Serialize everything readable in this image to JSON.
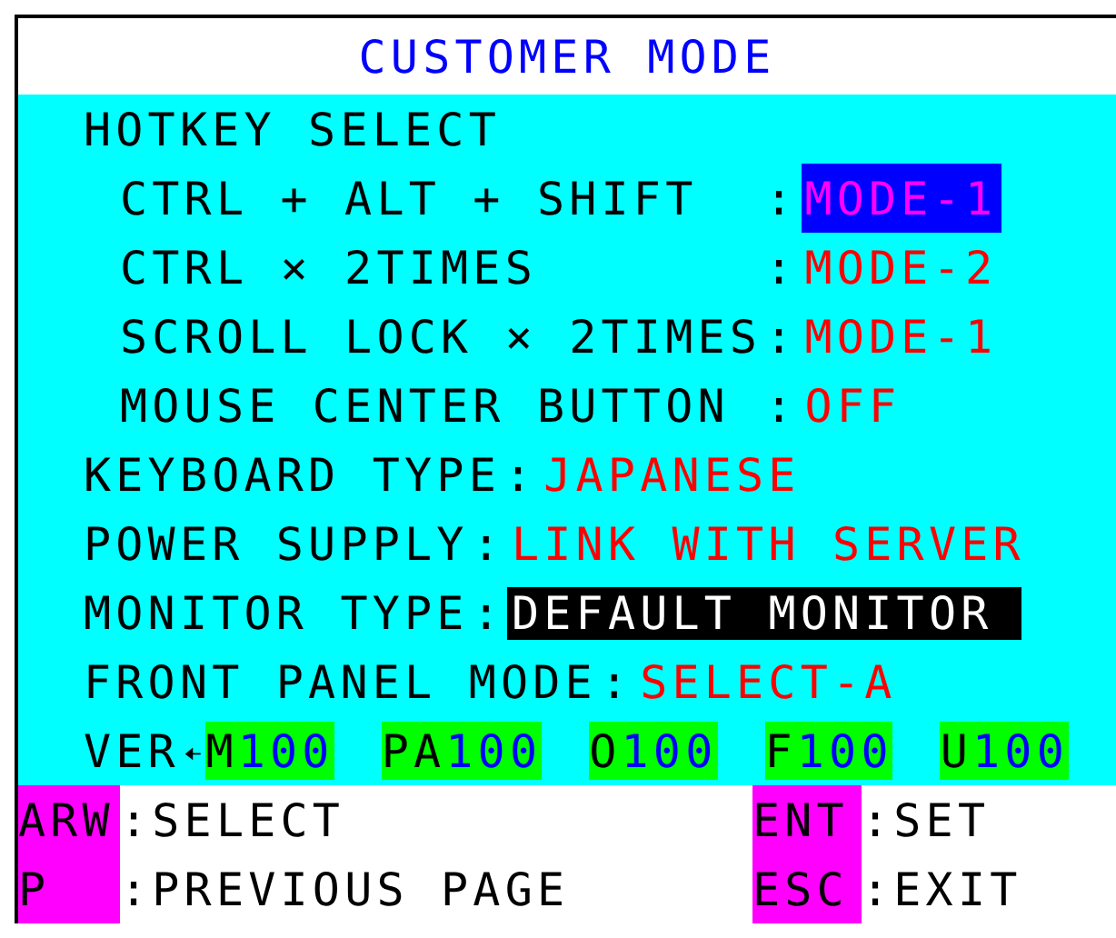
{
  "title": "CUSTOMER MODE",
  "hotkey": {
    "heading": "HOTKEY SELECT",
    "items": [
      {
        "label": "CTRL + ALT + SHIFT",
        "separator": ":",
        "value": "MODE-1",
        "selected": true,
        "inverted": false
      },
      {
        "label": "CTRL × 2TIMES",
        "separator": ":",
        "value": "MODE-2",
        "selected": false,
        "inverted": false
      },
      {
        "label": "SCROLL LOCK × 2TIMES",
        "separator": ":",
        "value": "MODE-1",
        "selected": false,
        "inverted": false
      },
      {
        "label": "MOUSE CENTER BUTTON",
        "separator": ":",
        "value": "OFF",
        "selected": false,
        "inverted": false
      }
    ]
  },
  "settings": [
    {
      "label": "KEYBOARD TYPE",
      "separator": ":",
      "value": "JAPANESE",
      "selected": false,
      "inverted": false
    },
    {
      "label": "POWER SUPPLY",
      "separator": ":",
      "value": "LINK WITH SERVER",
      "selected": false,
      "inverted": false
    },
    {
      "label": "MONITOR TYPE",
      "separator": ":",
      "value": "DEFAULT MONITOR",
      "selected": false,
      "inverted": true
    },
    {
      "label": "FRONT PANEL MODE",
      "separator": ":",
      "value": "SELECT-A",
      "selected": false,
      "inverted": false
    }
  ],
  "version": {
    "label": "VER",
    "modules": [
      {
        "prefix": "M",
        "number": "100"
      },
      {
        "prefix": "PA",
        "number": "100"
      },
      {
        "prefix": "O",
        "number": "100"
      },
      {
        "prefix": "F",
        "number": "100"
      },
      {
        "prefix": "U",
        "number": "100"
      }
    ]
  },
  "footer": [
    {
      "key": "ARW",
      "separator": ":",
      "action": "SELECT"
    },
    {
      "key": "ENT",
      "separator": ":",
      "action": "SET"
    },
    {
      "key": "P",
      "separator": ":",
      "action": "PREVIOUS PAGE"
    },
    {
      "key": "ESC",
      "separator": ":",
      "action": "EXIT"
    }
  ]
}
